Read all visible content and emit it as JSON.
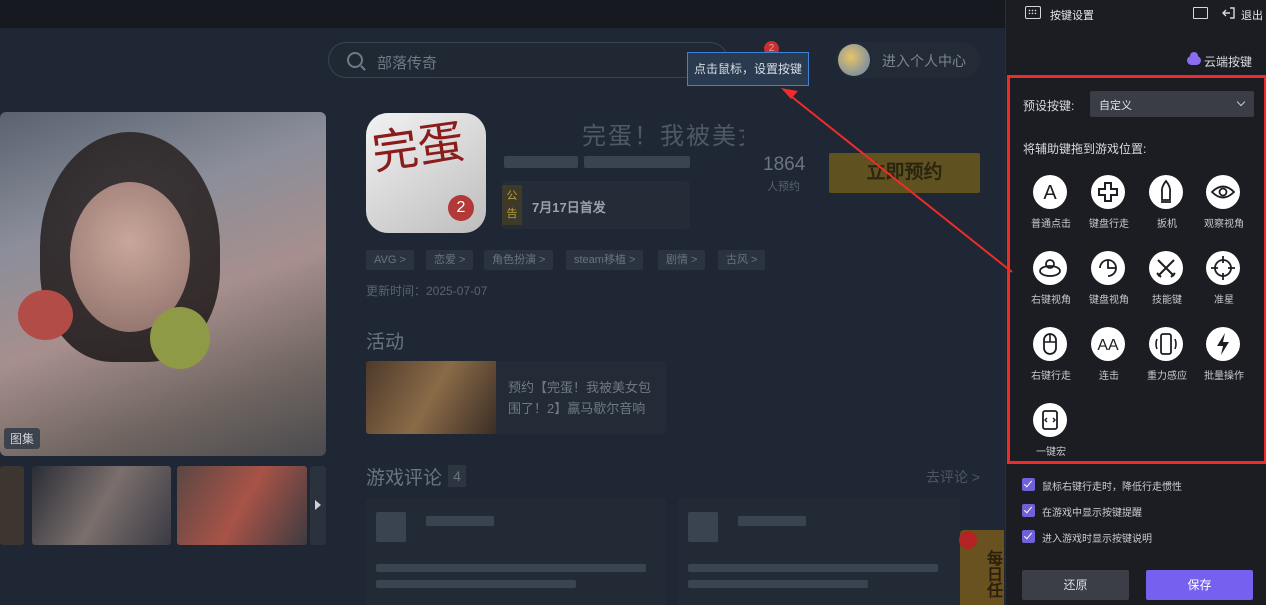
{
  "game_page": {
    "search_placeholder": "部落传奇",
    "notification_count": "2",
    "user_center_label": "进入个人中心",
    "tooltip_text": "点击鼠标，设置按键",
    "game_title": "完蛋！我被美女",
    "logo_text": "完蛋",
    "logo_number": "2",
    "notice_label": "公告",
    "notice_text": "7月17日首发",
    "reserve_count": "1864",
    "reserve_count_label": "人预约",
    "reserve_button": "立即预约",
    "gallery_label": "图集",
    "tags": [
      "AVG >",
      "恋爱 >",
      "角色扮演 >",
      "steam移植 >",
      "剧情 >",
      "古风 >"
    ],
    "update_time": "更新时间：2025-07-07",
    "activity_heading": "活动",
    "activity_text": "预约【完蛋！我被美女包围了！2】赢马歇尔音响",
    "reviews_heading": "游戏评论",
    "reviews_count": "4",
    "write_review": "去评论 >",
    "daily_badge": "每日任"
  },
  "key_panel": {
    "title": "按键设置",
    "exit_label": "退出",
    "cloud_keys": "云端按键",
    "preset_label": "预设按键:",
    "preset_value": "自定义",
    "drag_hint": "将辅助键拖到游戏位置:",
    "tools": [
      {
        "label": "普通点击",
        "icon": "letter-a-icon"
      },
      {
        "label": "键盘行走",
        "icon": "dpad-icon"
      },
      {
        "label": "扳机",
        "icon": "bullet-icon"
      },
      {
        "label": "观察视角",
        "icon": "eye-icon"
      },
      {
        "label": "右键视角",
        "icon": "right-view-icon"
      },
      {
        "label": "键盘视角",
        "icon": "keyboard-view-icon"
      },
      {
        "label": "技能键",
        "icon": "crossed-swords-icon"
      },
      {
        "label": "准星",
        "icon": "crosshair-icon"
      },
      {
        "label": "右键行走",
        "icon": "mouse-icon"
      },
      {
        "label": "连击",
        "icon": "double-a-icon"
      },
      {
        "label": "重力感应",
        "icon": "phone-tilt-icon"
      },
      {
        "label": "批量操作",
        "icon": "lightning-icon"
      },
      {
        "label": "一键宏",
        "icon": "macro-script-icon"
      }
    ],
    "options": [
      {
        "label": "鼠标右键行走时，降低行走惯性",
        "checked": true
      },
      {
        "label": "在游戏中显示按键提醒",
        "checked": true
      },
      {
        "label": "进入游戏时显示按键说明",
        "checked": true
      }
    ],
    "reset_button": "还原",
    "save_button": "保存"
  },
  "colors": {
    "accent": "#7560f0",
    "highlight_border": "#ef2b2b",
    "panel_bg": "#1b1d22"
  }
}
